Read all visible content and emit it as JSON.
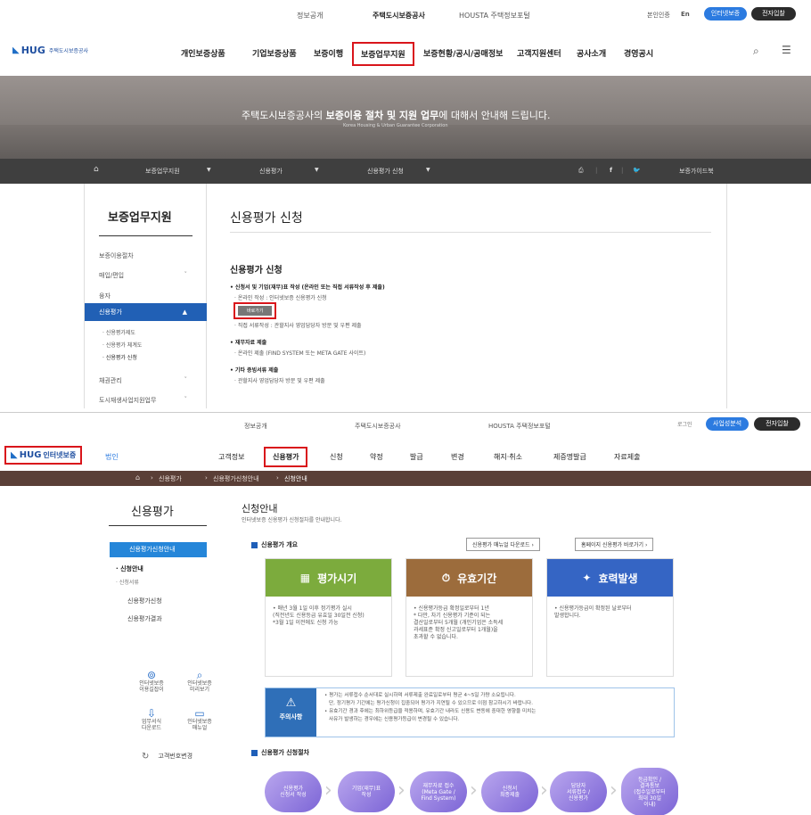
{
  "top": {
    "util": {
      "links": [
        "정보공개",
        "주택도시보증공사",
        "HOUSTA 주택정보포털"
      ],
      "auth": "본인인증",
      "lang": "En",
      "internet_btn": "인터넷보증",
      "e_btn": "전자입찰"
    },
    "logo": {
      "mark": "HUG",
      "text": "주택도시보증공사"
    },
    "gnb": [
      "개인보증상품",
      "기업보증상품",
      "보증이행",
      "보증업무지원",
      "보증현황/공시/공매정보",
      "고객지원센터",
      "공사소개",
      "경영공시"
    ],
    "hero": {
      "title_pre": "주택도시보증공사의 ",
      "title_bold": "보증이용 절차 및 지원 업무",
      "title_post": "에 대해서 안내해 드립니다.",
      "subtitle": "Korea Housing & Urban Guarantee Corporation"
    },
    "bar": {
      "crumbs": [
        "보증업무지원",
        "신용평가",
        "신용평가 신청"
      ],
      "guide": "보증가이드북"
    },
    "side": {
      "title": "보증업무지원",
      "items": [
        "보증이용절차",
        "매입/편입",
        "융자",
        "신용평가",
        "채권관리",
        "도시재생사업지원업무"
      ],
      "subs": [
        "· 신용평가제도",
        "· 신용평가 체계도",
        "· 신용평가 신청"
      ]
    },
    "main": {
      "title": "신용평가 신청",
      "subtitle": "신용평가 신청",
      "l1": "• 신청서 및 기업(재무)표 작성 (온라인 또는 직접 서류작성 후 제출)",
      "l2": "· 온라인 작성 : 인터넷보증 신용평가 신청",
      "btn": "바로가기",
      "l3": "· 직접 서류작성 : 관할지사 영업담당자 방문 및 우편 제출",
      "l4": "• 재무자료 제출",
      "l5": "· 온라인 제출 (FIND SYSTEM 또는 META GATE 사이트)",
      "l6": "• 기타 증빙서류 제출",
      "l7": "· 관할지사 영업담당자 방문 및 우편 제출"
    }
  },
  "bottom": {
    "util": {
      "links": [
        "정보공개",
        "주택도시보증공사",
        "HOUSTA 주택정보포털"
      ],
      "login": "로그인",
      "btn1": "사업성분석",
      "btn2": "전자입찰"
    },
    "logo": {
      "mark": "HUG",
      "text": "인터넷보증",
      "tag": "법인"
    },
    "gnb": [
      "고객정보",
      "신용평가",
      "신청",
      "약정",
      "발급",
      "변경",
      "해지·취소",
      "제증명발급",
      "자료제출"
    ],
    "crumbs": [
      "신용평가",
      "신용평가신청안내",
      "신청안내"
    ],
    "side": {
      "title": "신용평가",
      "active": "신용평가신청안내",
      "sub1": "· 신청안내",
      "sub2": "· 신청서류",
      "item1": "신용평가신청",
      "item2": "신용평가결과",
      "q1": "인터넷보증\n이용길잡이",
      "q2": "인터넷보증\n미리보기",
      "q3": "업무서식\n다운로드",
      "q4": "인터넷보증\n매뉴얼",
      "pw": "고객번호변경"
    },
    "main": {
      "title": "신청안내",
      "desc": "인터넷보증 신용평가 신청절차를 안내합니다.",
      "sec1": "신용평가 개요",
      "btn_manual": "신용평가 매뉴얼 다운로드 ›",
      "btn_home": "홈페이지 신용평가 바로가기 ›",
      "cards": [
        {
          "title": "평가시기",
          "color": "#7cab3d",
          "body": "• 매년 3월 1일 이후 정기평가 실시\n(직전년도 신용등급 유효일 30일전 신청)\n*3월 1일 이전에도 신청 가능"
        },
        {
          "title": "유효기간",
          "color": "#9c6c3c",
          "body": "• 신용평가등급 확정일로부터 1년\n* 다만, 차기 신용평가 기준이 되는\n결산일로부터 5개월 (개인기업은 소득세\n과세표준 확정 신고일로부터 1개월)을\n초과할 수 없습니다."
        },
        {
          "title": "효력발생",
          "color": "#3565c4",
          "body": "• 신용평가등급이 확정된 날로부터\n발생합니다."
        }
      ],
      "notice_title": "주의사항",
      "notice": [
        "• 평가는 서류접수 순서대로 실시하며 서류제출 완료일로부터 평균 4~5일 가량 소요됩니다.",
        "단, 정기평가 기간에는 평가신청이 집중되어 평가가 지연될 수 있으므로 이점 참고하시기 바랍니다.",
        "• 유효기간 경과 후에는 최하위등급을 적용하며, 유효기간 내라도 신용도 변동에 중대한 영향을 미치는",
        "사유가 발생하는 경우에는 신용평가등급이 변경될 수 있습니다."
      ],
      "sec2": "신용평가 신청절차",
      "steps": [
        "신용평가\n신청서 작성",
        "기업(재무)표\n작성",
        "재무자료 접수\n(Meta Gate /\nFind System)",
        "신청서\n최종제출",
        "담당자\n서류접수 /\n신용평가",
        "등급확인 /\n결과통보\n(접수일로부터\n최대 30일\n이내)"
      ]
    }
  }
}
